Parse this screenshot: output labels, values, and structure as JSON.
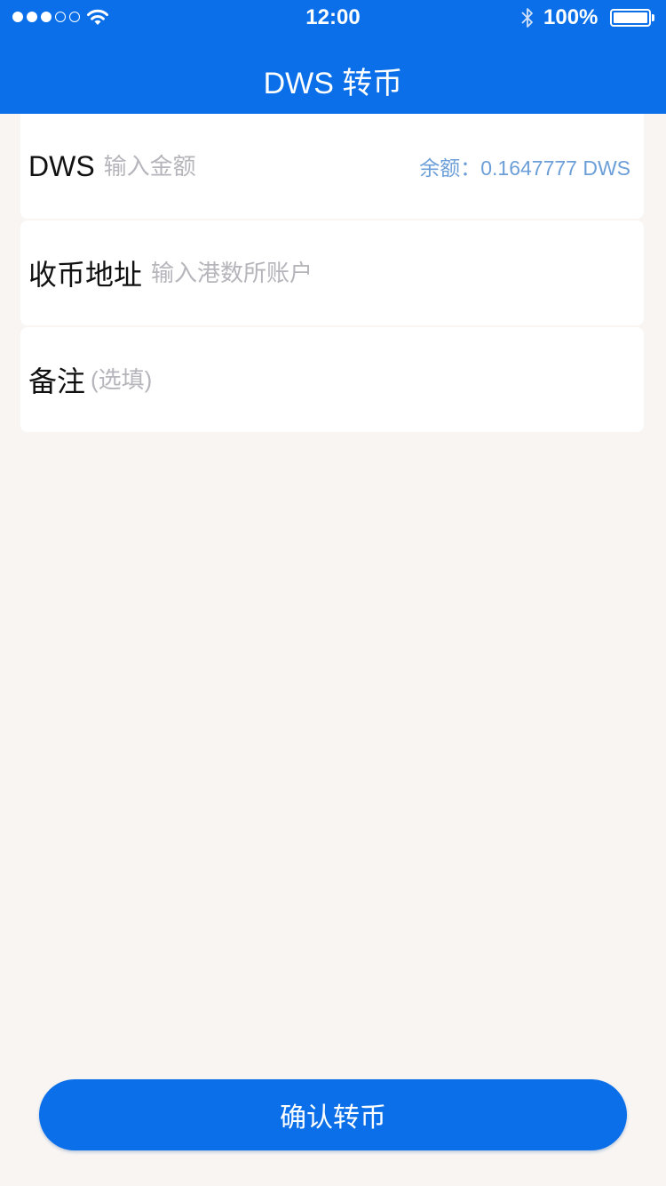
{
  "status_bar": {
    "time": "12:00",
    "battery_text": "100%",
    "signal_bars_filled": 3,
    "signal_bars_total": 5,
    "battery_level": 1.0
  },
  "header": {
    "title": "DWS 转币",
    "background_color": "#0a6fe8"
  },
  "form": {
    "amount": {
      "label": "DWS",
      "placeholder": "输入金额",
      "balance_text": "余额：0.1647777 DWS"
    },
    "address": {
      "label": "收币地址",
      "placeholder": "输入港数所账户"
    },
    "note": {
      "label": "备注",
      "placeholder": "(选填)"
    }
  },
  "confirm_button": {
    "label": "确认转币"
  },
  "icons": {
    "signal": "signal-dots-icon",
    "wifi": "wifi-icon",
    "bluetooth": "bluetooth-icon",
    "battery": "battery-icon"
  }
}
